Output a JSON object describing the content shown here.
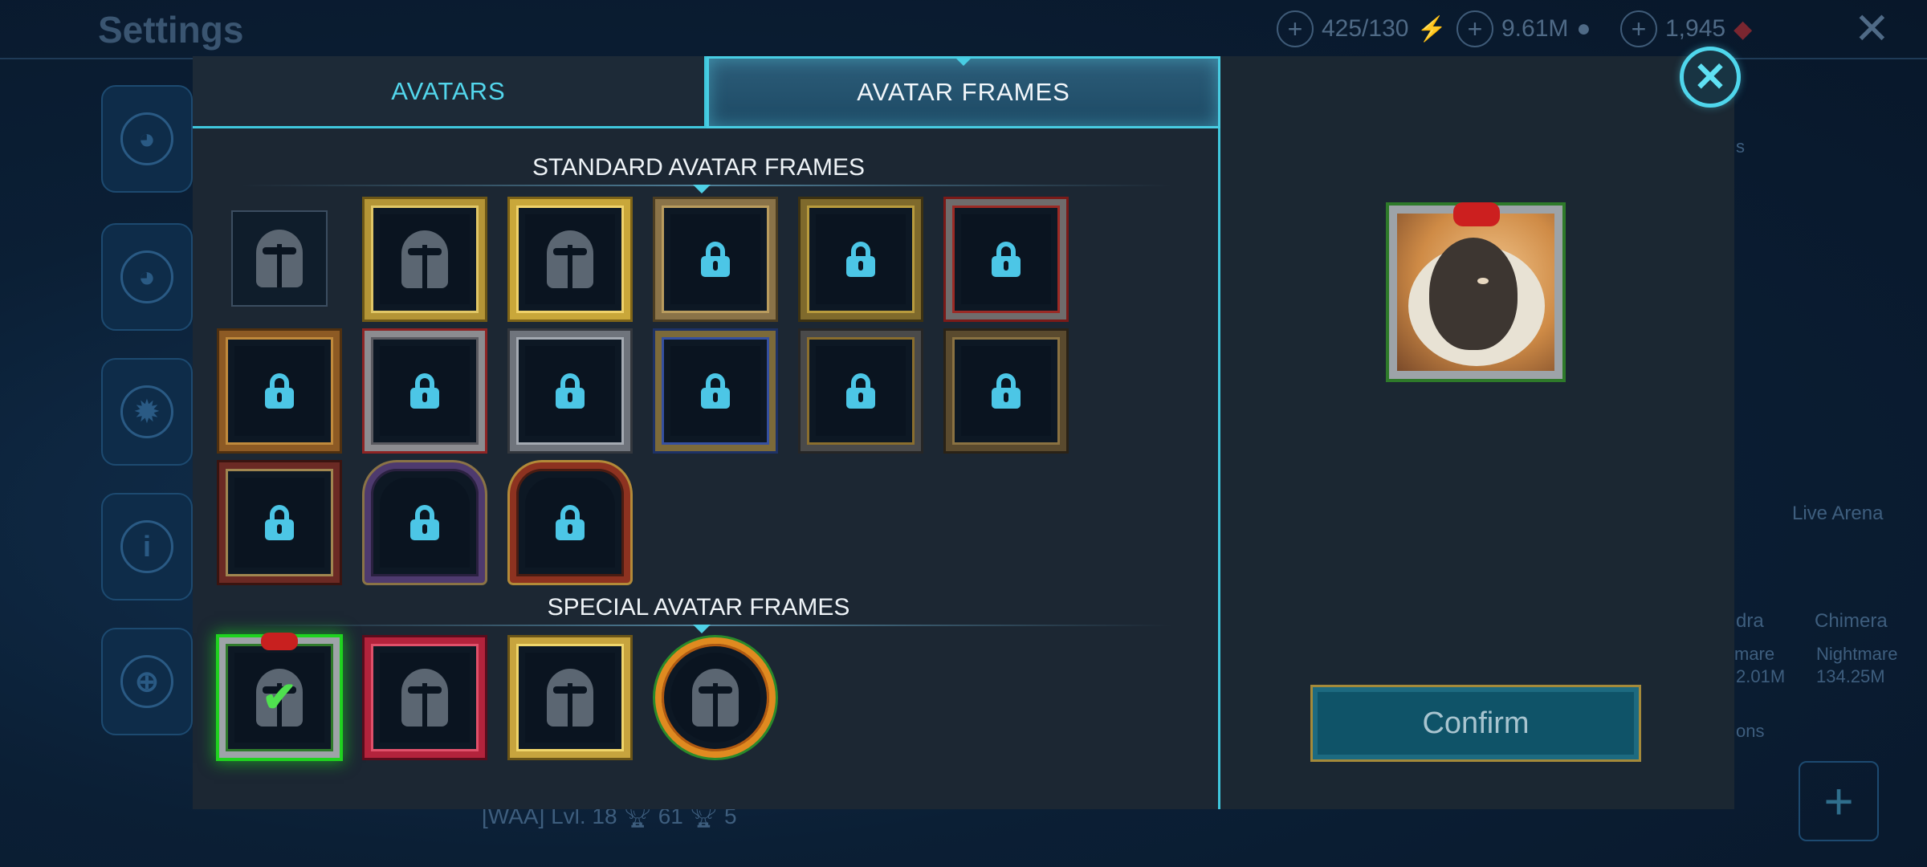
{
  "background": {
    "page_title": "Settings",
    "resources": [
      {
        "value": "425/130",
        "icon": "energy-icon"
      },
      {
        "value": "9.61M",
        "icon": "silver-icon"
      },
      {
        "value": "1,945",
        "icon": "gem-icon"
      }
    ],
    "arena_label": "Live Arena",
    "boss_left": {
      "name": "dra",
      "difficulty": "mare",
      "score": "2.01M"
    },
    "boss_right": {
      "name": "Chimera",
      "difficulty": "Nightmare",
      "score": "134.25M"
    },
    "panel_label_top": "s",
    "panel_label_bottom": "ons",
    "player_line": {
      "clan": "[WAA] Lvl. 18",
      "trophies": "61",
      "wins": "5"
    }
  },
  "modal": {
    "tabs": [
      {
        "label": "AVATARS",
        "active": false
      },
      {
        "label": "AVATAR FRAMES",
        "active": true
      }
    ],
    "sections": {
      "standard": {
        "title": "STANDARD AVATAR FRAMES",
        "frames": [
          {
            "style": "plain",
            "locked": false
          },
          {
            "style": "gold",
            "locked": false
          },
          {
            "style": "gold2",
            "locked": false
          },
          {
            "style": "bronze",
            "locked": true
          },
          {
            "style": "darkgold",
            "locked": true
          },
          {
            "style": "redsilver",
            "locked": true
          },
          {
            "style": "wood",
            "locked": true
          },
          {
            "style": "silverred",
            "locked": true
          },
          {
            "style": "silver",
            "locked": true
          },
          {
            "style": "blue",
            "locked": true
          },
          {
            "style": "chain",
            "locked": true
          },
          {
            "style": "dark",
            "locked": true
          },
          {
            "style": "redtrim",
            "locked": true
          },
          {
            "style": "purple",
            "locked": true
          },
          {
            "style": "castle",
            "locked": true
          }
        ]
      },
      "special": {
        "title": "SPECIAL AVATAR FRAMES",
        "frames": [
          {
            "style": "xmas",
            "locked": false,
            "selected": true
          },
          {
            "style": "crimson",
            "locked": false
          },
          {
            "style": "laurel",
            "locked": false
          },
          {
            "style": "fire",
            "locked": false
          }
        ]
      }
    },
    "preview": {
      "avatar": "sheep-portrait",
      "frame": "xmas"
    },
    "confirm_label": "Confirm",
    "colors": {
      "accent": "#3fc7dd",
      "lock": "#4cc6e6",
      "selected": "#1fd31f"
    }
  }
}
